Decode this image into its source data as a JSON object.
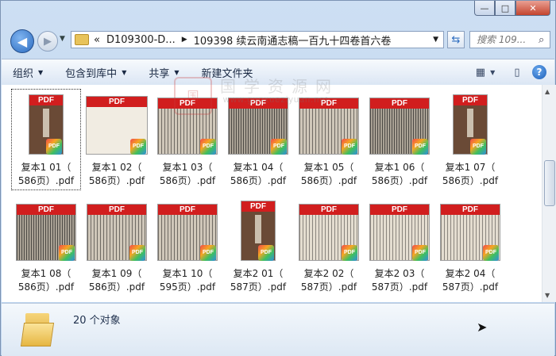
{
  "window": {
    "caption_buttons": {
      "minimize": "—",
      "maximize": "□",
      "close": "✕"
    }
  },
  "address": {
    "prefix": "«",
    "crumbs": [
      "D109300-D...",
      "109398 续云南通志稿一百九十四卷首六卷"
    ]
  },
  "search": {
    "placeholder": "搜索 109..."
  },
  "toolbar": {
    "organize": "组织",
    "include_library": "包含到库中",
    "share": "共享",
    "new_folder": "新建文件夹"
  },
  "files": [
    {
      "line1": "复本1 01（",
      "line2": "586页）.pdf",
      "style": "cover",
      "selected": true
    },
    {
      "line1": "复本1 02（",
      "line2": "586页）.pdf",
      "style": "title"
    },
    {
      "line1": "复本1 03（",
      "line2": "586页）.pdf",
      "style": "wide"
    },
    {
      "line1": "复本1 04（",
      "line2": "586页）.pdf",
      "style": "dark"
    },
    {
      "line1": "复本1 05（",
      "line2": "586页）.pdf",
      "style": "wide"
    },
    {
      "line1": "复本1 06（",
      "line2": "586页）.pdf",
      "style": "dark"
    },
    {
      "line1": "复本1 07（",
      "line2": "586页）.pdf",
      "style": "cover"
    },
    {
      "line1": "复本1 08（",
      "line2": "586页）.pdf",
      "style": "dark"
    },
    {
      "line1": "复本1 09（",
      "line2": "586页）.pdf",
      "style": "wide"
    },
    {
      "line1": "复本1 10（",
      "line2": "595页）.pdf",
      "style": "wide"
    },
    {
      "line1": "复本2 01（",
      "line2": "587页）.pdf",
      "style": "cover"
    },
    {
      "line1": "复本2 02（",
      "line2": "587页）.pdf",
      "style": "light"
    },
    {
      "line1": "复本2 03（",
      "line2": "587页）.pdf",
      "style": "light"
    },
    {
      "line1": "复本2 04（",
      "line2": "587页）.pdf",
      "style": "light"
    }
  ],
  "pdf_label": "PDF",
  "badge_label": "PDF",
  "watermark": {
    "seal": "国",
    "main": "国学资源网",
    "url": "www.guoxueziyuan.net"
  },
  "status": {
    "count": "20 个对象"
  },
  "colors": {
    "pdf_red": "#d11e1e",
    "selection": "#333333"
  }
}
